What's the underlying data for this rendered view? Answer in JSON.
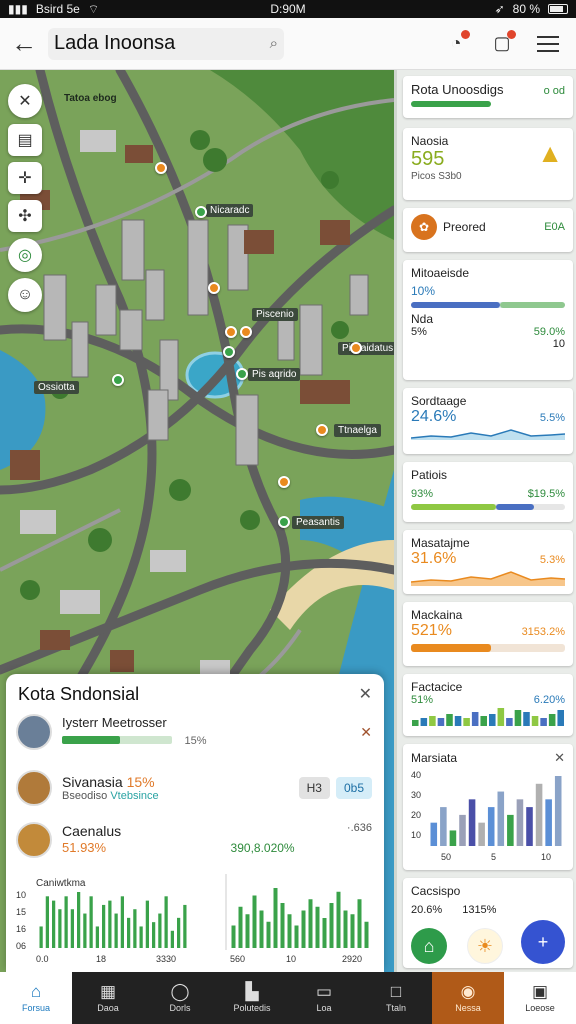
{
  "status": {
    "left": "Bsird 5e",
    "time": "D:90M",
    "battery": "80 %"
  },
  "appbar": {
    "back_icon": "arrow-left-icon",
    "title": "Lada Inoonsa",
    "search_icon": "search-icon"
  },
  "map": {
    "labels": {
      "l1": "Tatoa ebog",
      "l2": "Nicaradc",
      "l3": "Piscenio",
      "l4": "Piscaidatus",
      "l5": "Ossiotta",
      "l6": "Pis aqrido",
      "l7": "Ttnaelga",
      "l8": "Peasantis"
    }
  },
  "sheet": {
    "title": "Kota Sndonsial",
    "row1": {
      "name": "Iysterr Meetrosser",
      "progress": 0.53,
      "pct": "15%"
    },
    "row2": {
      "name": "Sivanasia",
      "highlight": "15%",
      "sub_a": "Bseodiso",
      "sub_b": "Vtebsince",
      "chip1": "H3",
      "chip2": "0b5"
    },
    "row3": {
      "name": "Caenalus",
      "val1": "51.93%",
      "val2": "390,8.020%",
      "right": "·.636",
      "chart_label": "Caniwtkma"
    }
  },
  "panel": {
    "card1": {
      "title": "Rota Unoosdigs",
      "right": "o od"
    },
    "card2": {
      "title": "Naosia",
      "big": "595",
      "sub": "Picos S3b0"
    },
    "card3": {
      "title": "Preored",
      "right": "E0A"
    },
    "card4": {
      "title": "Mitoaeisde",
      "a": "10%",
      "b": "Nda",
      "c": "5%",
      "d": "59.0%",
      "e": "10"
    },
    "card5": {
      "title": "Sordtaage",
      "big": "24.6%",
      "right": "5.5%"
    },
    "card6": {
      "title": "Patiois",
      "a": "93%",
      "b": "$19.5%"
    },
    "card7": {
      "title": "Masatajme",
      "big": "31.6%",
      "right": "5.3%"
    },
    "card8": {
      "title": "Mackaina",
      "big": "521%",
      "right": "3153.2%"
    },
    "card9": {
      "title": "Factacice",
      "a": "51%",
      "b": "6.20%"
    },
    "card10": {
      "title": "Marsiata"
    },
    "card11": {
      "title": "Cacsispo",
      "a": "20.6%",
      "b": "1315%",
      "fab1": "park-icon",
      "fab2": "sun-icon",
      "fab3": "plus-icon"
    }
  },
  "nav": [
    {
      "label": "Forsua",
      "icon": "home-icon"
    },
    {
      "label": "Daoa",
      "icon": "grid-icon"
    },
    {
      "label": "Dorls",
      "icon": "compass-icon"
    },
    {
      "label": "Polutedis",
      "icon": "buildings-icon"
    },
    {
      "label": "Loa",
      "icon": "map-icon"
    },
    {
      "label": "Ttaln",
      "icon": "square-icon"
    },
    {
      "label": "Nessa",
      "icon": "badge-icon"
    },
    {
      "label": "Loeose",
      "icon": "window-icon"
    }
  ],
  "chart_data": [
    {
      "type": "bar",
      "title": "Caniwtkma",
      "values": [
        5,
        12,
        11,
        9,
        12,
        9,
        13,
        8,
        12,
        5,
        10,
        11,
        8,
        12,
        7,
        9,
        5,
        11,
        6,
        8,
        12,
        4,
        7,
        10
      ],
      "xlabels": [
        "0.0",
        "18",
        "3330"
      ],
      "ylabels": [
        "10",
        "15",
        "16",
        "06"
      ]
    },
    {
      "type": "bar",
      "values": [
        6,
        11,
        9,
        14,
        10,
        7,
        16,
        12,
        9,
        6,
        10,
        13,
        11,
        8,
        12,
        15,
        10,
        9,
        13,
        7
      ],
      "xlabels": [
        "560",
        "10",
        "2920"
      ]
    },
    {
      "type": "bar",
      "title": "Factacice",
      "series": [
        {
          "values": [
            3,
            4,
            5,
            4,
            6,
            5,
            4,
            7,
            5,
            6,
            9,
            4,
            8,
            7,
            5,
            4,
            6,
            8
          ]
        }
      ]
    },
    {
      "type": "bar",
      "title": "Marsiata",
      "values": [
        3,
        5,
        2,
        4,
        6,
        3,
        5,
        7,
        4,
        6,
        5,
        8,
        6,
        9
      ],
      "ylabels": [
        "40",
        "30",
        "20",
        "10"
      ],
      "xlabels": [
        "50",
        "5",
        "10"
      ]
    }
  ]
}
